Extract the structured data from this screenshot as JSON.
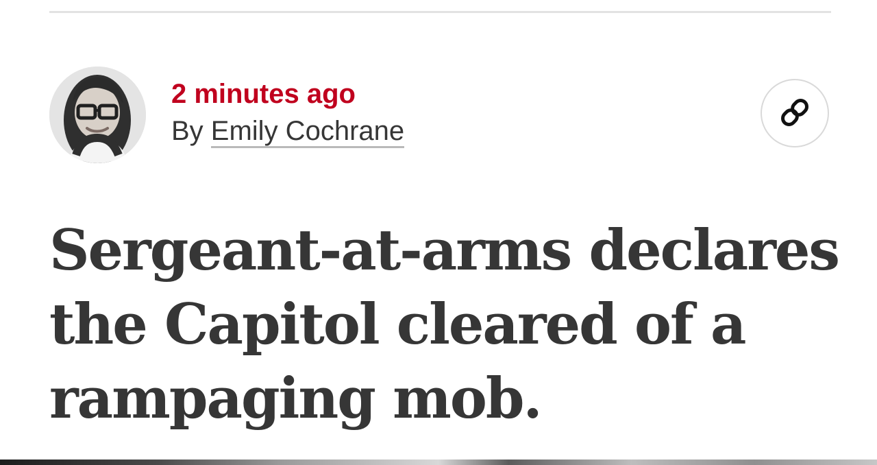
{
  "post": {
    "timestamp": "2 minutes ago",
    "byline_prefix": "By ",
    "author": "Emily Cochrane",
    "headline": "Sergeant-at-arms declares the Capitol cleared of a rampaging mob."
  },
  "icons": {
    "share": "link-icon"
  },
  "colors": {
    "timestamp": "#c0001e",
    "text": "#363636",
    "rule": "#e2e2e2"
  }
}
